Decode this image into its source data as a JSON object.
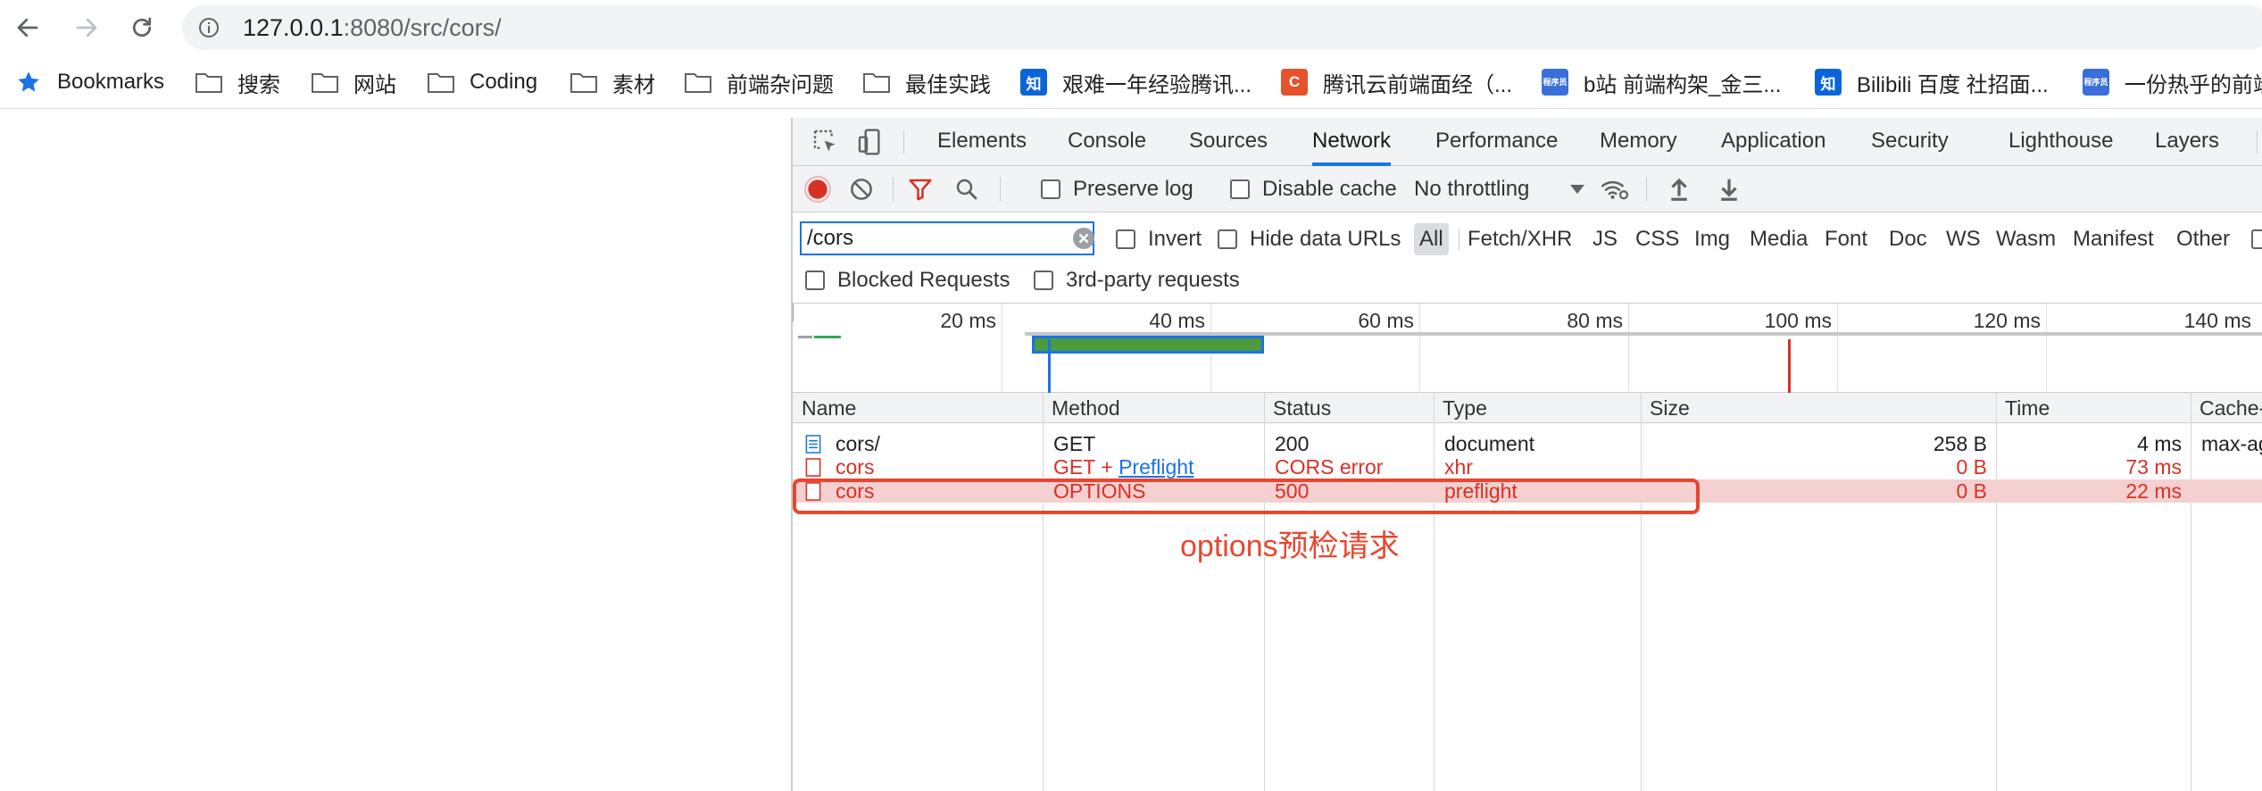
{
  "browser": {
    "url_host": "127.0.0.1",
    "url_rest": ":8080/src/cors/"
  },
  "bookmarks": [
    {
      "label": "Bookmarks",
      "icon": "star-icon"
    },
    {
      "label": "搜索",
      "icon": "folder-icon"
    },
    {
      "label": "网站",
      "icon": "folder-icon"
    },
    {
      "label": "Coding",
      "icon": "folder-icon"
    },
    {
      "label": "素材",
      "icon": "folder-icon"
    },
    {
      "label": "前端杂问题",
      "icon": "folder-icon"
    },
    {
      "label": "最佳实践",
      "icon": "folder-icon"
    },
    {
      "label": "艰难一年经验腾讯...",
      "icon": "zhihu-icon",
      "badge": "知"
    },
    {
      "label": "腾讯云前端面经（...",
      "icon": "csdn-icon",
      "badge": "C"
    },
    {
      "label": "b站 前端构架_金三...",
      "icon": "programmer-icon",
      "badge": "程序员"
    },
    {
      "label": "Bilibili 百度 社招面...",
      "icon": "zhihu-icon",
      "badge": "知"
    },
    {
      "label": "一份热乎的前端",
      "icon": "programmer-icon",
      "badge": "程序员"
    }
  ],
  "devtools": {
    "tabs": [
      "Elements",
      "Console",
      "Sources",
      "Network",
      "Performance",
      "Memory",
      "Application",
      "Security",
      "Lighthouse",
      "Layers"
    ],
    "active_tab": "Network",
    "controls": {
      "preserve_log": "Preserve log",
      "disable_cache": "Disable cache",
      "throttling": "No throttling"
    },
    "filter": {
      "value": "/cors",
      "invert": "Invert",
      "hide_data_urls": "Hide data URLs",
      "types": [
        "All",
        "Fetch/XHR",
        "JS",
        "CSS",
        "Img",
        "Media",
        "Font",
        "Doc",
        "WS",
        "Wasm",
        "Manifest",
        "Other"
      ],
      "active_type": "All",
      "blocked_requests": "Blocked Requests",
      "third_party": "3rd-party requests"
    },
    "overview": {
      "ticks": [
        "20 ms",
        "40 ms",
        "60 ms",
        "80 ms",
        "100 ms",
        "120 ms",
        "140 ms"
      ]
    },
    "table": {
      "headers": [
        "Name",
        "Method",
        "Status",
        "Type",
        "Size",
        "Time",
        "Cache-"
      ],
      "rows": [
        {
          "name": "cors/",
          "method": "GET",
          "method_link": "",
          "status": "200",
          "type": "document",
          "size": "258 B",
          "time": "4 ms",
          "cache": "max-ag"
        },
        {
          "name": "cors",
          "method": "GET + ",
          "method_link": "Preflight",
          "status": "CORS error",
          "type": "xhr",
          "size": "0 B",
          "time": "73 ms",
          "cache": ""
        },
        {
          "name": "cors",
          "method": "OPTIONS",
          "method_link": "",
          "status": "500",
          "type": "preflight",
          "size": "0 B",
          "time": "22 ms",
          "cache": ""
        }
      ]
    },
    "annotation": "options预检请求",
    "colors": {
      "accent": "#1a73e8",
      "error": "#d93025",
      "annotation": "#e8462f",
      "selected_row": "#f5d0d0"
    }
  }
}
